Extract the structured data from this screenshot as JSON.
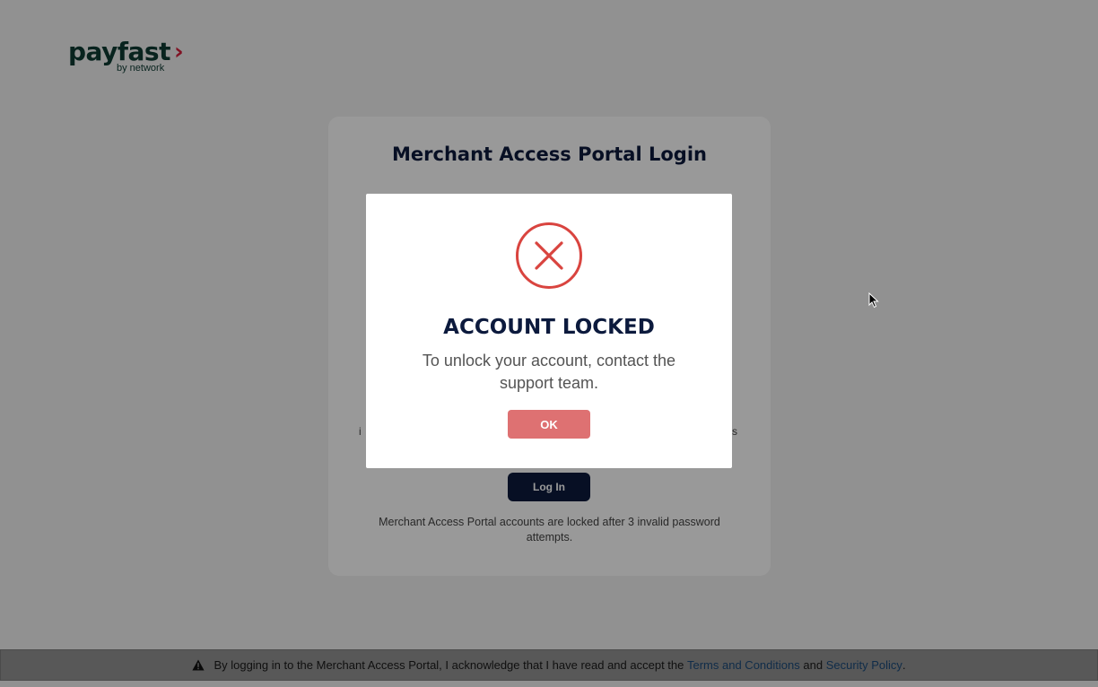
{
  "logo": {
    "main": "payfast",
    "arrow": "›",
    "sub": "by network"
  },
  "card": {
    "title": "Merchant Access Portal Login",
    "cut_left": "i",
    "cut_right": "s",
    "login_label": "Log In",
    "lock_note": "Merchant Access Portal accounts are locked after 3 invalid password attempts."
  },
  "modal": {
    "icon": "error-x-icon",
    "title": "ACCOUNT LOCKED",
    "text": "To unlock your account, contact the support team.",
    "ok_label": "OK"
  },
  "footer": {
    "icon": "warning-icon",
    "text": "By logging in to the Merchant Access Portal, I acknowledge that I have read and accept the",
    "link1": "Terms and Conditions",
    "and": "and",
    "link2": "Security Policy",
    "period": "."
  },
  "colors": {
    "error": "#d9443f",
    "ok_button": "#de7172",
    "navy": "#0c1a3d",
    "brand_green": "#0e3b33",
    "brand_red": "#d6203d"
  }
}
